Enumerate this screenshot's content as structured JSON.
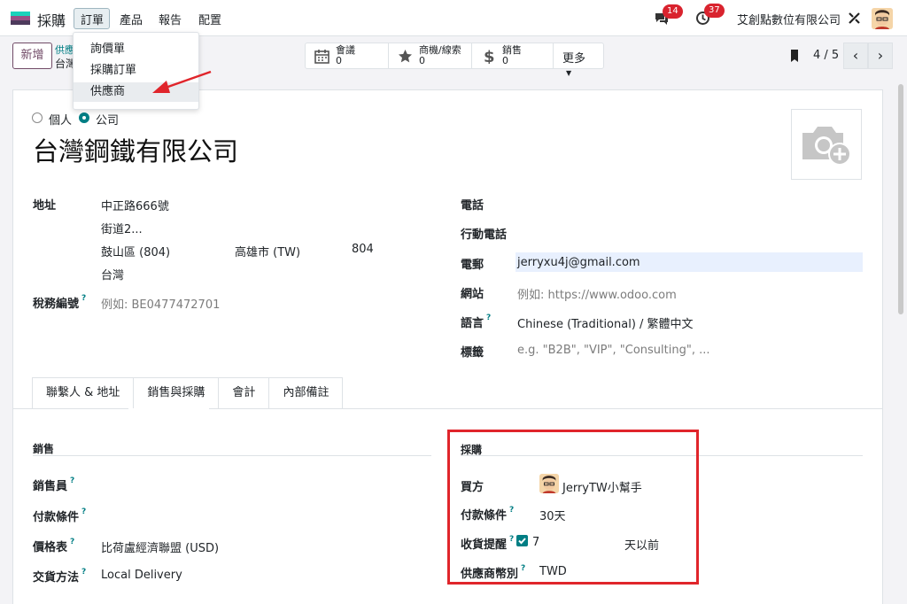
{
  "navbar": {
    "app_name": "採購",
    "menu": [
      "訂單",
      "產品",
      "報告",
      "配置"
    ],
    "messages_count": "14",
    "activities_count": "37",
    "company": "艾創點數位有限公司"
  },
  "dropdown": {
    "items": [
      "詢價單",
      "採購訂單",
      "供應商"
    ],
    "active_index": 2
  },
  "control_panel": {
    "new_label": "新增",
    "breadcrumb": "供應",
    "breadcrumb_sub": "台灣",
    "smart_buttons": [
      {
        "label": "會議",
        "value": "0",
        "icon": "calendar-icon"
      },
      {
        "label": "商機/線索",
        "value": "0",
        "icon": "star-icon"
      },
      {
        "label": "銷售",
        "value": "0",
        "icon": "dollar-icon"
      }
    ],
    "more_label": "更多",
    "pager": "4 / 5"
  },
  "form": {
    "type_options": [
      "個人",
      "公司"
    ],
    "type_selected": "公司",
    "name": "台灣鋼鐵有限公司",
    "address_label": "地址",
    "street": "中正路666號",
    "street2": "街道2...",
    "district": "鼓山區 (804)",
    "city": "高雄市 (TW)",
    "zip": "804",
    "country": "台灣",
    "tax_label": "稅務編號",
    "tax_placeholder": "例如: BE0477472701",
    "phone_label": "電話",
    "mobile_label": "行動電話",
    "email_label": "電郵",
    "email": "jerryxu4j@gmail.com",
    "website_label": "網站",
    "website_placeholder": "例如: https://www.odoo.com",
    "language_label": "語言",
    "language": "Chinese (Traditional) / 繁體中文",
    "tags_label": "標籤",
    "tags_placeholder": "e.g. \"B2B\", \"VIP\", \"Consulting\", ..."
  },
  "tabs": [
    "聯繫人 & 地址",
    "銷售與採購",
    "會計",
    "內部備註"
  ],
  "active_tab": 1,
  "sales": {
    "title": "銷售",
    "salesperson_label": "銷售員",
    "payment_terms_label": "付款條件",
    "pricelist_label": "價格表",
    "pricelist": "比荷盧經濟聯盟 (USD)",
    "delivery_label": "交貨方法",
    "delivery": "Local Delivery"
  },
  "purchase": {
    "title": "採購",
    "buyer_label": "買方",
    "buyer": "JerryTW小幫手",
    "payment_terms_label": "付款條件",
    "payment_terms": "30天",
    "receipt_reminder_label": "收貨提醒",
    "receipt_reminder_checked": true,
    "reminder_days": "7",
    "reminder_suffix": "天以前",
    "currency_label": "供應商幣別",
    "currency": "TWD"
  },
  "help_mark": "?",
  "colors": {
    "brand": "#714b67",
    "accent": "#017e84",
    "highlight": "#e0252b",
    "badge": "#d9232e"
  }
}
